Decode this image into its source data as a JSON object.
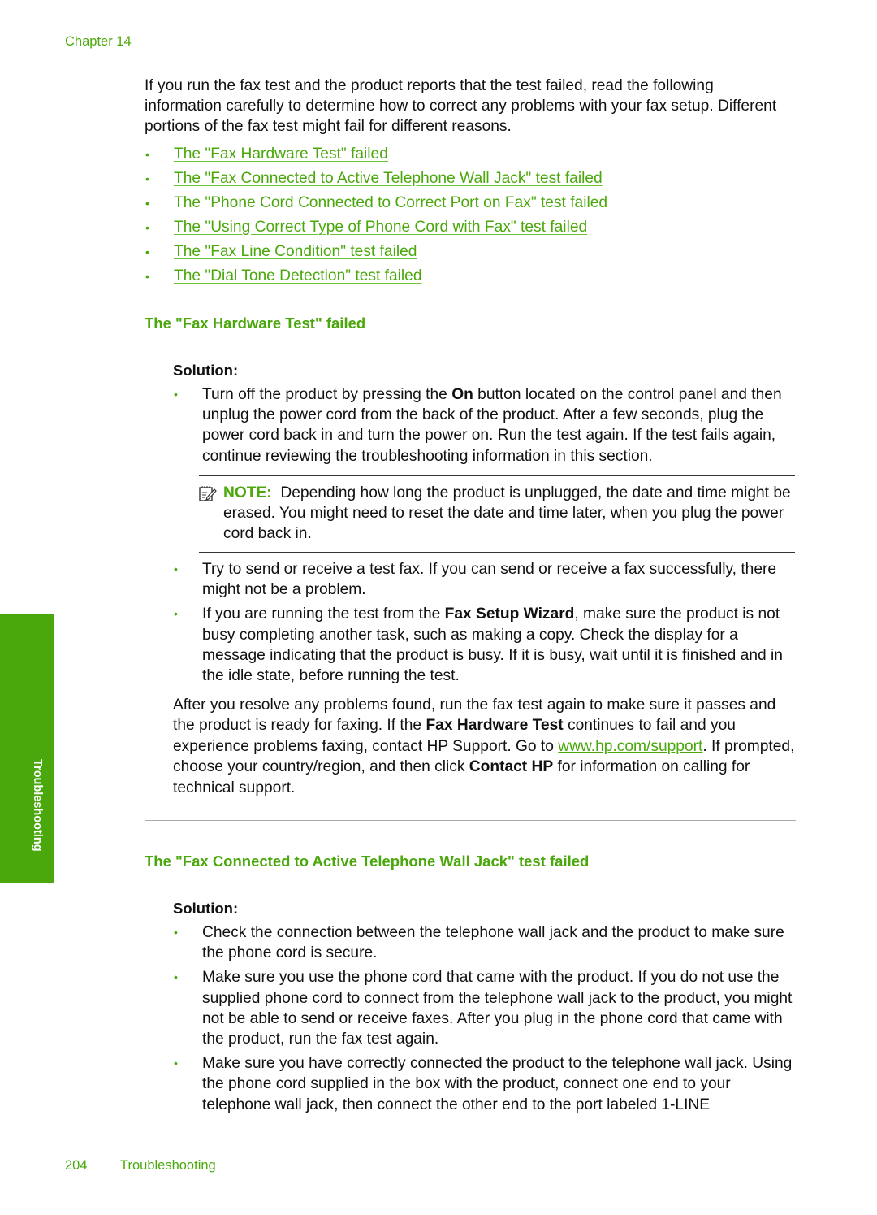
{
  "header": {
    "chapter": "Chapter 14"
  },
  "intro": "If you run the fax test and the product reports that the test failed, read the following information carefully to determine how to correct any problems with your fax setup. Different portions of the fax test might fail for different reasons.",
  "toc": [
    "The \"Fax Hardware Test\" failed",
    "The \"Fax Connected to Active Telephone Wall Jack\" test failed",
    "The \"Phone Cord Connected to Correct Port on Fax\" test failed",
    "The \"Using Correct Type of Phone Cord with Fax\" test failed",
    "The \"Fax Line Condition\" test failed",
    "The \"Dial Tone Detection\" test failed"
  ],
  "section1": {
    "title": "The \"Fax Hardware Test\" failed",
    "solution_label": "Solution:",
    "bullet1": {
      "pre": "Turn off the product by pressing the ",
      "bold": "On",
      "post": " button located on the control panel and then unplug the power cord from the back of the product. After a few seconds, plug the power cord back in and turn the power on. Run the test again. If the test fails again, continue reviewing the troubleshooting information in this section."
    },
    "note": {
      "label": "NOTE:",
      "text": "Depending how long the product is unplugged, the date and time might be erased. You might need to reset the date and time later, when you plug the power cord back in.",
      "icon": "note-pencil-icon"
    },
    "bullet2": "Try to send or receive a test fax. If you can send or receive a fax successfully, there might not be a problem.",
    "bullet3": {
      "pre": "If you are running the test from the ",
      "bold": "Fax Setup Wizard",
      "post": ", make sure the product is not busy completing another task, such as making a copy. Check the display for a message indicating that the product is busy. If it is busy, wait until it is finished and in the idle state, before running the test."
    },
    "after": {
      "t1": "After you resolve any problems found, run the fax test again to make sure it passes and the product is ready for faxing. If the ",
      "b1": "Fax Hardware Test",
      "t2": " continues to fail and you experience problems faxing, contact HP Support. Go to ",
      "link": "www.hp.com/support",
      "t3": ". If prompted, choose your country/region, and then click ",
      "b2": "Contact HP",
      "t4": " for information on calling for technical support."
    }
  },
  "section2": {
    "title": "The \"Fax Connected to Active Telephone Wall Jack\" test failed",
    "solution_label": "Solution:",
    "bullets": [
      "Check the connection between the telephone wall jack and the product to make sure the phone cord is secure.",
      "Make sure you use the phone cord that came with the product. If you do not use the supplied phone cord to connect from the telephone wall jack to the product, you might not be able to send or receive faxes. After you plug in the phone cord that came with the product, run the fax test again.",
      "Make sure you have correctly connected the product to the telephone wall jack. Using the phone cord supplied in the box with the product, connect one end to your telephone wall jack, then connect the other end to the port labeled 1-LINE"
    ]
  },
  "side_tab": "Troubleshooting",
  "footer": {
    "page_number": "204",
    "section": "Troubleshooting"
  },
  "colors": {
    "accent": "#4aa80c"
  }
}
